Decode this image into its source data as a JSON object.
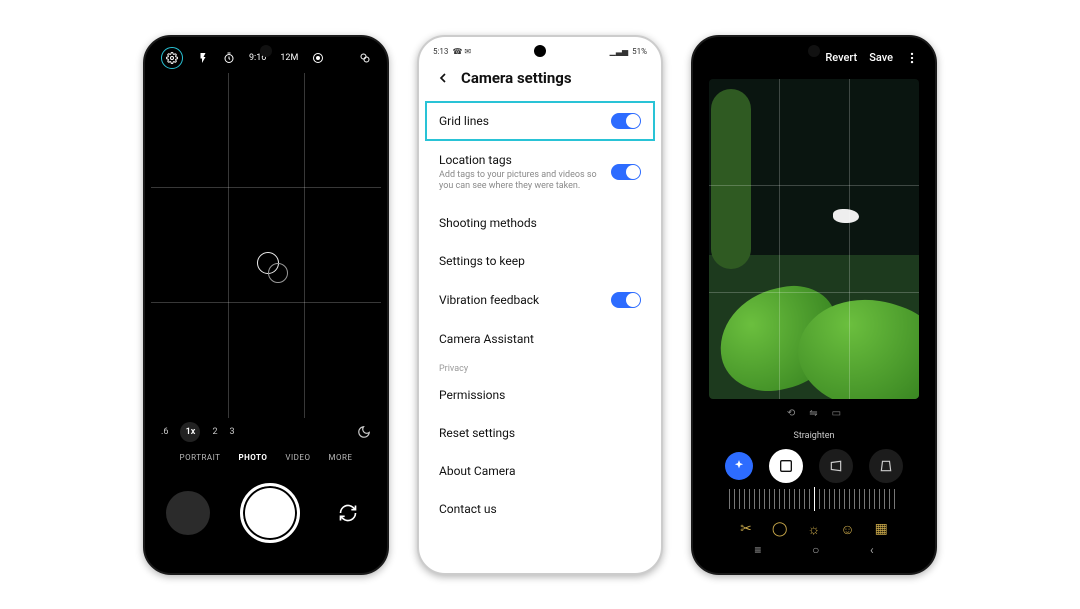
{
  "phone1": {
    "topbar": {
      "timer": "9:16",
      "resolution": "12M",
      "zoom_options": [
        ".6",
        "1x",
        "2",
        "3"
      ],
      "modes": [
        "PORTRAIT",
        "PHOTO",
        "VIDEO",
        "MORE"
      ],
      "active_mode": "PHOTO"
    }
  },
  "phone2": {
    "status": {
      "time": "5:13",
      "battery": "51%"
    },
    "title": "Camera settings",
    "items": {
      "grid_lines": "Grid lines",
      "location_tags": "Location tags",
      "location_tags_sub": "Add tags to your pictures and videos so you can see where they were taken.",
      "shooting_methods": "Shooting methods",
      "settings_to_keep": "Settings to keep",
      "vibration": "Vibration feedback",
      "camera_assistant": "Camera Assistant",
      "privacy_label": "Privacy",
      "permissions": "Permissions",
      "reset": "Reset settings",
      "about": "About Camera",
      "contact": "Contact us"
    }
  },
  "phone3": {
    "revert": "Revert",
    "save": "Save",
    "straighten": "Straighten"
  }
}
